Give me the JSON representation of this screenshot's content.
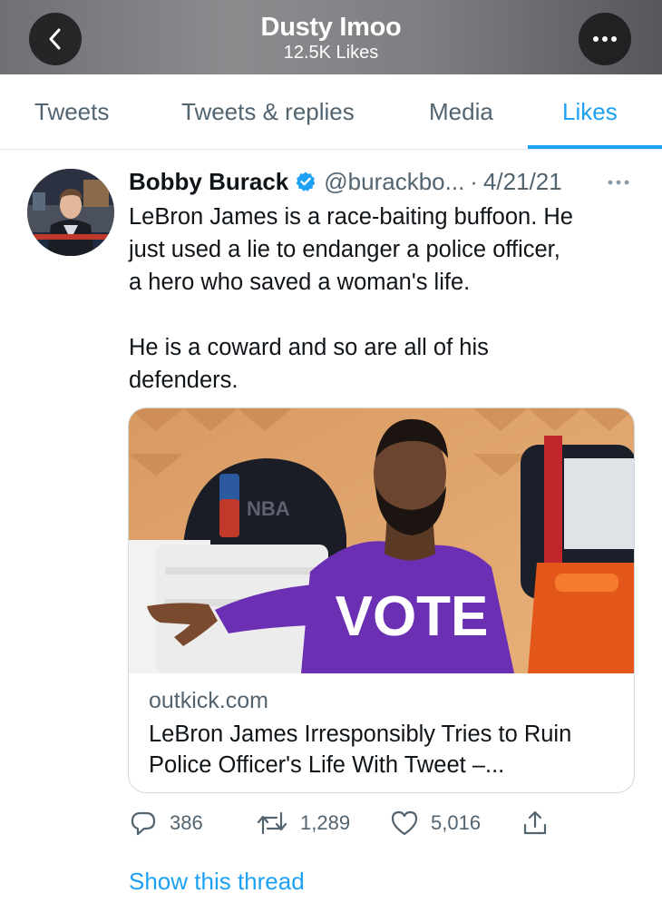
{
  "header": {
    "title": "Dusty Imoo",
    "subtitle": "12.5K Likes",
    "back_icon": "chevron-left-icon",
    "more_icon": "more-horizontal-icon"
  },
  "tabs": [
    {
      "label": "Tweets",
      "active": false
    },
    {
      "label": "Tweets & replies",
      "active": false
    },
    {
      "label": "Media",
      "active": false
    },
    {
      "label": "Likes",
      "active": true
    }
  ],
  "tweet": {
    "author": "Bobby Burack",
    "verified": true,
    "handle": "@burackbo...",
    "separator": "·",
    "date": "4/21/21",
    "text": "LeBron James is a race-baiting buffoon. He\njust used a lie to endanger a police officer,\na hero who saved a woman's life.\n\nHe is a coward and so are all of his\ndefenders.",
    "card": {
      "image_jersey_text": "VOTE",
      "domain": "outkick.com",
      "title": "LeBron James Irresponsibly Tries to Ruin Police Officer's Life With Tweet –..."
    },
    "actions": {
      "replies": "386",
      "retweets": "1,289",
      "likes": "5,016"
    },
    "show_thread": "Show this thread"
  },
  "colors": {
    "accent": "#1da1f2",
    "secondary_text": "#536471",
    "jersey_purple": "#6b2fb3"
  }
}
